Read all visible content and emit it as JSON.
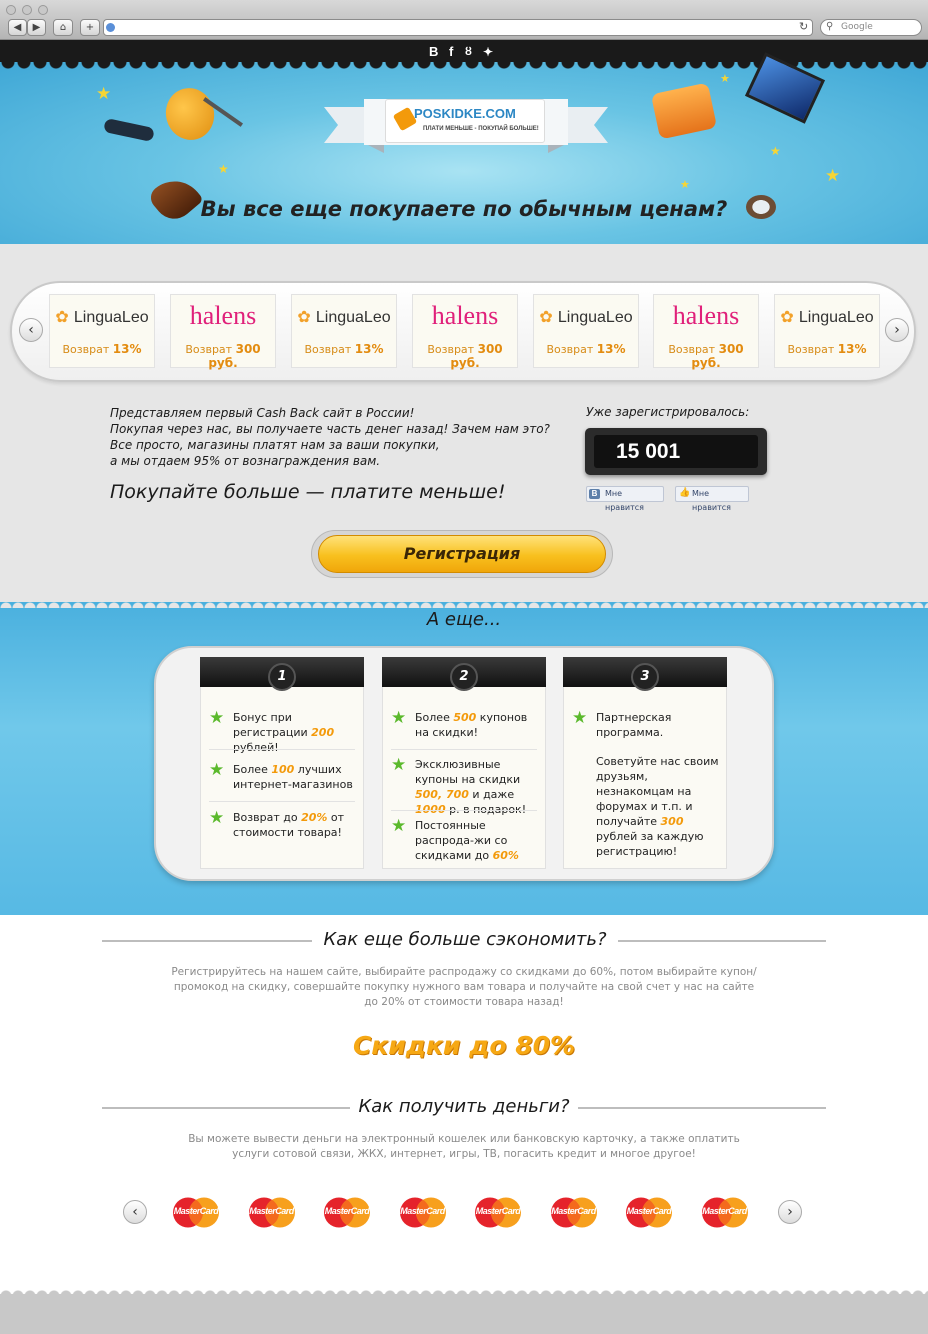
{
  "browser": {
    "search_placeholder": "Google",
    "nav_back": "◀",
    "nav_forward": "▶",
    "home": "⌂",
    "new_tab": "+",
    "reload": "↻"
  },
  "social": {
    "vk": "В",
    "facebook": "f",
    "odnoklassniki": "ok",
    "twitter": "tw"
  },
  "hero": {
    "logo_text": "POSKIDKE.COM",
    "logo_slogan": "ПЛАТИ МЕНЬШЕ - ПОКУПАЙ БОЛЬШЕ!",
    "title": "Вы все еще покупаете по обычным ценам?"
  },
  "stores": [
    {
      "name": "LinguaLeo",
      "type": "lingualeo",
      "cashback_label": "Возврат",
      "cashback_value": "13%"
    },
    {
      "name": "halens",
      "type": "halens",
      "cashback_label": "Возврат",
      "cashback_value": "300 руб."
    },
    {
      "name": "LinguaLeo",
      "type": "lingualeo",
      "cashback_label": "Возврат",
      "cashback_value": "13%"
    },
    {
      "name": "halens",
      "type": "halens",
      "cashback_label": "Возврат",
      "cashback_value": "300 руб."
    },
    {
      "name": "LinguaLeo",
      "type": "lingualeo",
      "cashback_label": "Возврат",
      "cashback_value": "13%"
    },
    {
      "name": "halens",
      "type": "halens",
      "cashback_label": "Возврат",
      "cashback_value": "300 руб."
    },
    {
      "name": "LinguaLeo",
      "type": "lingualeo",
      "cashback_label": "Возврат",
      "cashback_value": "13%"
    }
  ],
  "intro": {
    "lines": [
      "Представляем первый Cash Back сайт в России!",
      "Покупая через нас, вы получаете часть денег назад! Зачем нам это?",
      "Все просто, магазины платят нам за ваши покупки,",
      "а мы отдаем 95% от вознаграждения вам."
    ],
    "slogan": "Покупайте больше — платите меньше!"
  },
  "stats": {
    "registered_label": "Уже зарегистрировалось:",
    "registered_count": "15 001",
    "like_vk": "Мне нравится",
    "like_fb": "Мне нравится"
  },
  "register_button": "Регистрация",
  "features": {
    "title": "А еще...",
    "columns": [
      {
        "number": "1",
        "items": [
          {
            "parts": [
              "Бонус при регистрации ",
              "200",
              " рублей!"
            ]
          },
          {
            "parts": [
              "Более ",
              "100",
              " лучших интернет-магазинов"
            ]
          },
          {
            "parts": [
              "Возврат до ",
              "20%",
              " от стоимости товара!"
            ]
          }
        ]
      },
      {
        "number": "2",
        "items": [
          {
            "parts": [
              "Более ",
              "500",
              " купонов на скидки!"
            ]
          },
          {
            "parts": [
              "Эксклюзивные купоны на скидки ",
              "500, 700",
              " и даже ",
              "1000",
              " р. в подарок!"
            ]
          },
          {
            "parts": [
              "Постоянные распрода-жи со скидками до ",
              "60%",
              ""
            ]
          }
        ]
      },
      {
        "number": "3",
        "items": [
          {
            "parts": [
              "Партнерская программа.",
              "",
              ""
            ]
          }
        ],
        "extra": [
          "Советуйте нас своим друзьям, незнакомцам на форумах и т.п. и получайте ",
          "300",
          " рублей за каждую регистрацию!"
        ]
      }
    ]
  },
  "save_more": {
    "title": "Как еще больше сэкономить?",
    "text": "Регистрируйтесь на нашем сайте, выбирайте распродажу со скидками до 60%, потом выбирайте купон/промокод на скидку, совершайте покупку нужного вам товара и получайте на свой счет у нас на сайте до 20% от стоимости товара назад!",
    "promo": "Скидки до 80%"
  },
  "withdraw": {
    "title": "Как получить деньги?",
    "text": "Вы можете вывести деньги на электронный кошелек или банковскую карточку, а также оплатить услуги сотовой связи, ЖКХ, интернет, игры, ТВ, погасить кредит и многое другое!",
    "payment_label": "MasterCard",
    "payment_count": 8
  },
  "colors": {
    "accent": "#f39a0b",
    "blue": "#4ab0de",
    "green_star": "#5bb92c",
    "halens": "#e0207a"
  }
}
